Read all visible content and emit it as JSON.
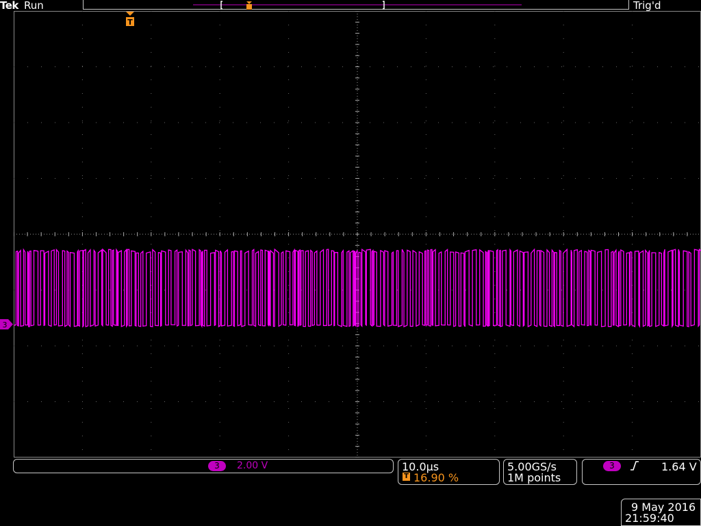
{
  "header": {
    "brand": "Tek",
    "run_state": "Run",
    "trigger_state": "Trig'd"
  },
  "channel": {
    "number": "3",
    "scale": "2.00 V",
    "color": "#c000c0"
  },
  "horizontal": {
    "time_per_div": "10.0µs",
    "trigger_marker": "T",
    "trigger_position": "16.90 %",
    "marker_color": "#f7941d"
  },
  "acquisition": {
    "sample_rate": "5.00GS/s",
    "record_length": "1M points"
  },
  "trigger": {
    "channel": "3",
    "slope_icon": "rising-edge-icon",
    "level": "1.64 V"
  },
  "datetime": {
    "date": "9 May 2016",
    "time": "21:59:40"
  },
  "waveform": {
    "type": "digital-pulse-train",
    "color": "#ff00ff"
  }
}
